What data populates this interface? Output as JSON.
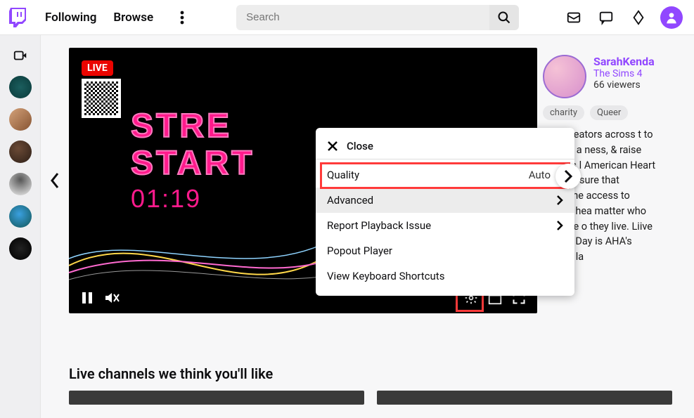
{
  "nav": {
    "following": "Following",
    "browse": "Browse"
  },
  "search": {
    "placeholder": "Search"
  },
  "player": {
    "live_badge": "LIVE",
    "title_line1": "STRE",
    "title_line2": "START",
    "timer": "01:19"
  },
  "settings_menu": {
    "close": "Close",
    "quality_label": "Quality",
    "quality_value": "Auto",
    "advanced": "Advanced",
    "report": "Report Playback Issue",
    "popout": "Popout Player",
    "shortcuts": "View Keyboard Shortcuts"
  },
  "channel": {
    "name": "SarahKenda",
    "game": "The Sims 4",
    "viewers": "66 viewers",
    "tags": [
      "charity",
      "Queer"
    ],
    "description": "Join creators across t to spread a         ness, & raise crit         nds l American Heart Asso ensure that everyone access to quality hea matter who they are o they live. Liive for Wo Day is AHA's official la"
  },
  "recommendations": {
    "heading": "Live channels we think you'll like"
  },
  "colors": {
    "accent": "#9147ff",
    "live": "#eb0400",
    "highlight": "#ff3a3a"
  }
}
